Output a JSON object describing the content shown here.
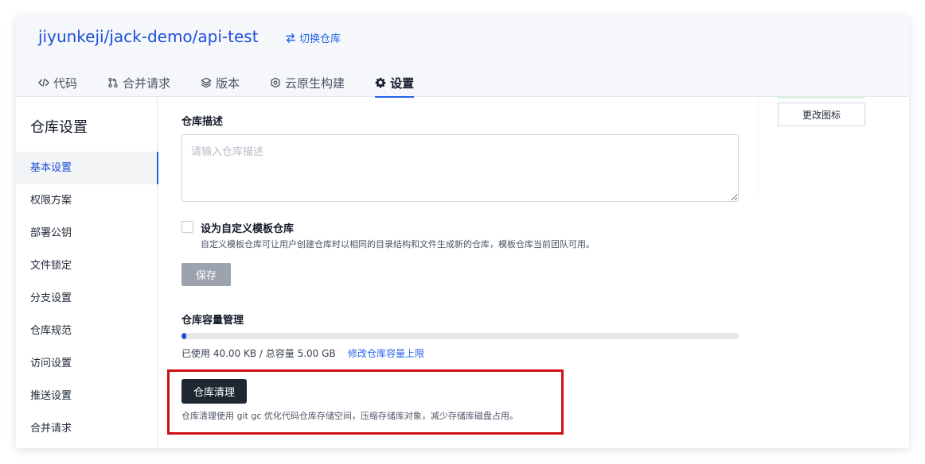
{
  "header": {
    "repo_owner": "jiyunkeji",
    "repo_group": "jack-demo",
    "repo_name": "api-test",
    "separator": "/",
    "switch_repo_label": "切换仓库",
    "tabs": [
      {
        "label": "代码",
        "icon": "code-icon"
      },
      {
        "label": "合并请求",
        "icon": "merge-request-icon"
      },
      {
        "label": "版本",
        "icon": "layers-icon"
      },
      {
        "label": "云原生构建",
        "icon": "cloud-build-icon"
      },
      {
        "label": "设置",
        "icon": "gear-icon",
        "active": true
      }
    ]
  },
  "sidebar": {
    "title": "仓库设置",
    "items": [
      {
        "label": "基本设置",
        "active": true
      },
      {
        "label": "权限方案"
      },
      {
        "label": "部署公钥"
      },
      {
        "label": "文件锁定"
      },
      {
        "label": "分支设置"
      },
      {
        "label": "仓库规范"
      },
      {
        "label": "访问设置"
      },
      {
        "label": "推送设置"
      },
      {
        "label": "合并请求"
      }
    ]
  },
  "main": {
    "description_label": "仓库描述",
    "description_placeholder": "请输入仓库描述",
    "description_value": "",
    "template_checkbox_label": "设为自定义模板仓库",
    "template_checkbox_checked": false,
    "template_hint": "自定义模板仓库可让用户创建仓库时以相同的目录结构和文件生成新的仓库，模板仓库当前团队可用。",
    "save_label": "保存",
    "capacity_label": "仓库容量管理",
    "usage_text": "已使用 40.00 KB / 总容量 5.00 GB",
    "usage_percent": 0.0008,
    "modify_capacity_link": "修改仓库容量上限",
    "cleanup_label": "仓库清理",
    "cleanup_hint": "仓库清理使用 git gc 优化代码仓库存储空间，压缩存储库对象，减少存储库磁盘占用。"
  },
  "right_panel": {
    "change_icon_label": "更改图标"
  },
  "colors": {
    "accent": "#2563eb",
    "highlight_box": "#cc1016",
    "cleanup_button": "#1f2733",
    "save_button_disabled": "#9ca3af"
  }
}
